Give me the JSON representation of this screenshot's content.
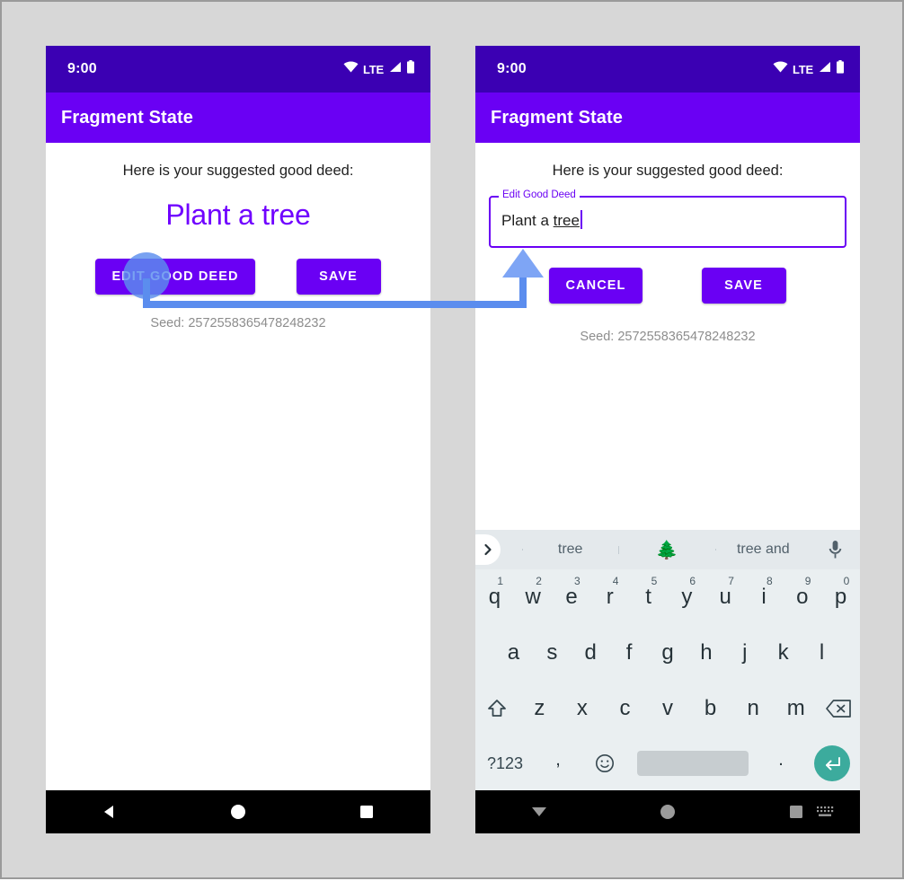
{
  "theme": {
    "status_bar_color": "#3b00b3",
    "app_bar_color": "#6a00f4",
    "accent_color": "#7000ff",
    "button_color": "#6a00f4",
    "annotation_color": "#5b8dee",
    "page_background": "#d7d7d7",
    "keyboard_background": "#eaeff1",
    "enter_key_color": "#3cab9d"
  },
  "status_bar": {
    "time": "9:00",
    "network_label": "LTE",
    "icons": [
      "wifi-icon",
      "signal-icon",
      "battery-icon"
    ]
  },
  "app_bar": {
    "title": "Fragment State"
  },
  "left_screen": {
    "name": "view-state",
    "suggestion_label": "Here is your suggested good deed:",
    "good_deed": "Plant a tree",
    "buttons": [
      {
        "id": "edit-good-deed",
        "label": "EDIT GOOD DEED"
      },
      {
        "id": "save",
        "label": "SAVE"
      }
    ],
    "seed_text": "Seed: 2572558365478248232"
  },
  "right_screen": {
    "name": "edit-state",
    "suggestion_label": "Here is your suggested good deed:",
    "text_field": {
      "label": "Edit Good Deed",
      "value_prefix": "Plant a ",
      "value_composing": "tree",
      "full_value": "Plant a tree",
      "placeholder": "Edit Good Deed"
    },
    "buttons": [
      {
        "id": "cancel",
        "label": "CANCEL"
      },
      {
        "id": "save",
        "label": "SAVE"
      }
    ],
    "seed_text": "Seed: 2572558365478248232"
  },
  "keyboard": {
    "suggestions": [
      {
        "type": "text",
        "label": "tree"
      },
      {
        "type": "emoji",
        "label": "🌲"
      },
      {
        "type": "text",
        "label": "tree and"
      }
    ],
    "expand_icon": "chevron-right-icon",
    "mic_icon": "microphone-icon",
    "rows": {
      "row1": [
        {
          "key": "q",
          "num": "1"
        },
        {
          "key": "w",
          "num": "2"
        },
        {
          "key": "e",
          "num": "3"
        },
        {
          "key": "r",
          "num": "4"
        },
        {
          "key": "t",
          "num": "5"
        },
        {
          "key": "y",
          "num": "6"
        },
        {
          "key": "u",
          "num": "7"
        },
        {
          "key": "i",
          "num": "8"
        },
        {
          "key": "o",
          "num": "9"
        },
        {
          "key": "p",
          "num": "0"
        }
      ],
      "row2": [
        "a",
        "s",
        "d",
        "f",
        "g",
        "h",
        "j",
        "k",
        "l"
      ],
      "row3": [
        "z",
        "x",
        "c",
        "v",
        "b",
        "n",
        "m"
      ],
      "shift_icon": "shift-icon",
      "backspace_icon": "backspace-icon",
      "row4": {
        "symbols_label": "?123",
        "comma": ",",
        "emoji_icon": "emoji-smiley-icon",
        "space_label": "",
        "period": ".",
        "enter_icon": "enter-return-icon"
      }
    }
  },
  "nav_bar": {
    "left": [
      "back-triangle-icon",
      "home-circle-icon",
      "recents-square-icon"
    ],
    "right": [
      "dismiss-keyboard-down-icon",
      "home-circle-icon",
      "recents-square-icon",
      "show-keyboard-icon"
    ]
  },
  "annotation": {
    "type": "tap-and-flow-arrow",
    "tap_target": "edit-good-deed",
    "description": "Tapping EDIT GOOD DEED leads to the edit text field"
  }
}
